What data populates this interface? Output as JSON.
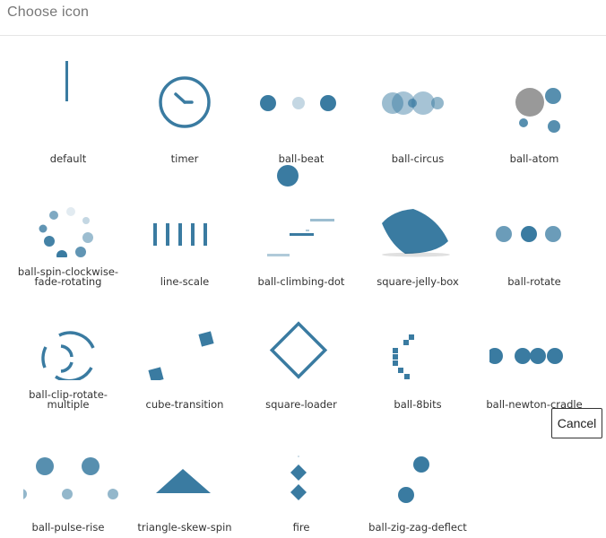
{
  "dialog": {
    "title": "Choose icon",
    "cancel_label": "Cancel"
  },
  "accent_color": "#3a7ba1",
  "icons": [
    {
      "name": "default"
    },
    {
      "name": "timer"
    },
    {
      "name": "ball-beat"
    },
    {
      "name": "ball-circus"
    },
    {
      "name": "ball-atom"
    },
    {
      "name": "ball-spin-clockwise-fade-rotating"
    },
    {
      "name": "line-scale"
    },
    {
      "name": "ball-climbing-dot"
    },
    {
      "name": "square-jelly-box"
    },
    {
      "name": "ball-rotate"
    },
    {
      "name": "ball-clip-rotate-multiple"
    },
    {
      "name": "cube-transition"
    },
    {
      "name": "square-loader"
    },
    {
      "name": "ball-8bits"
    },
    {
      "name": "ball-newton-cradle"
    },
    {
      "name": "ball-pulse-rise"
    },
    {
      "name": "triangle-skew-spin"
    },
    {
      "name": "fire"
    },
    {
      "name": "ball-zig-zag-deflect"
    }
  ]
}
